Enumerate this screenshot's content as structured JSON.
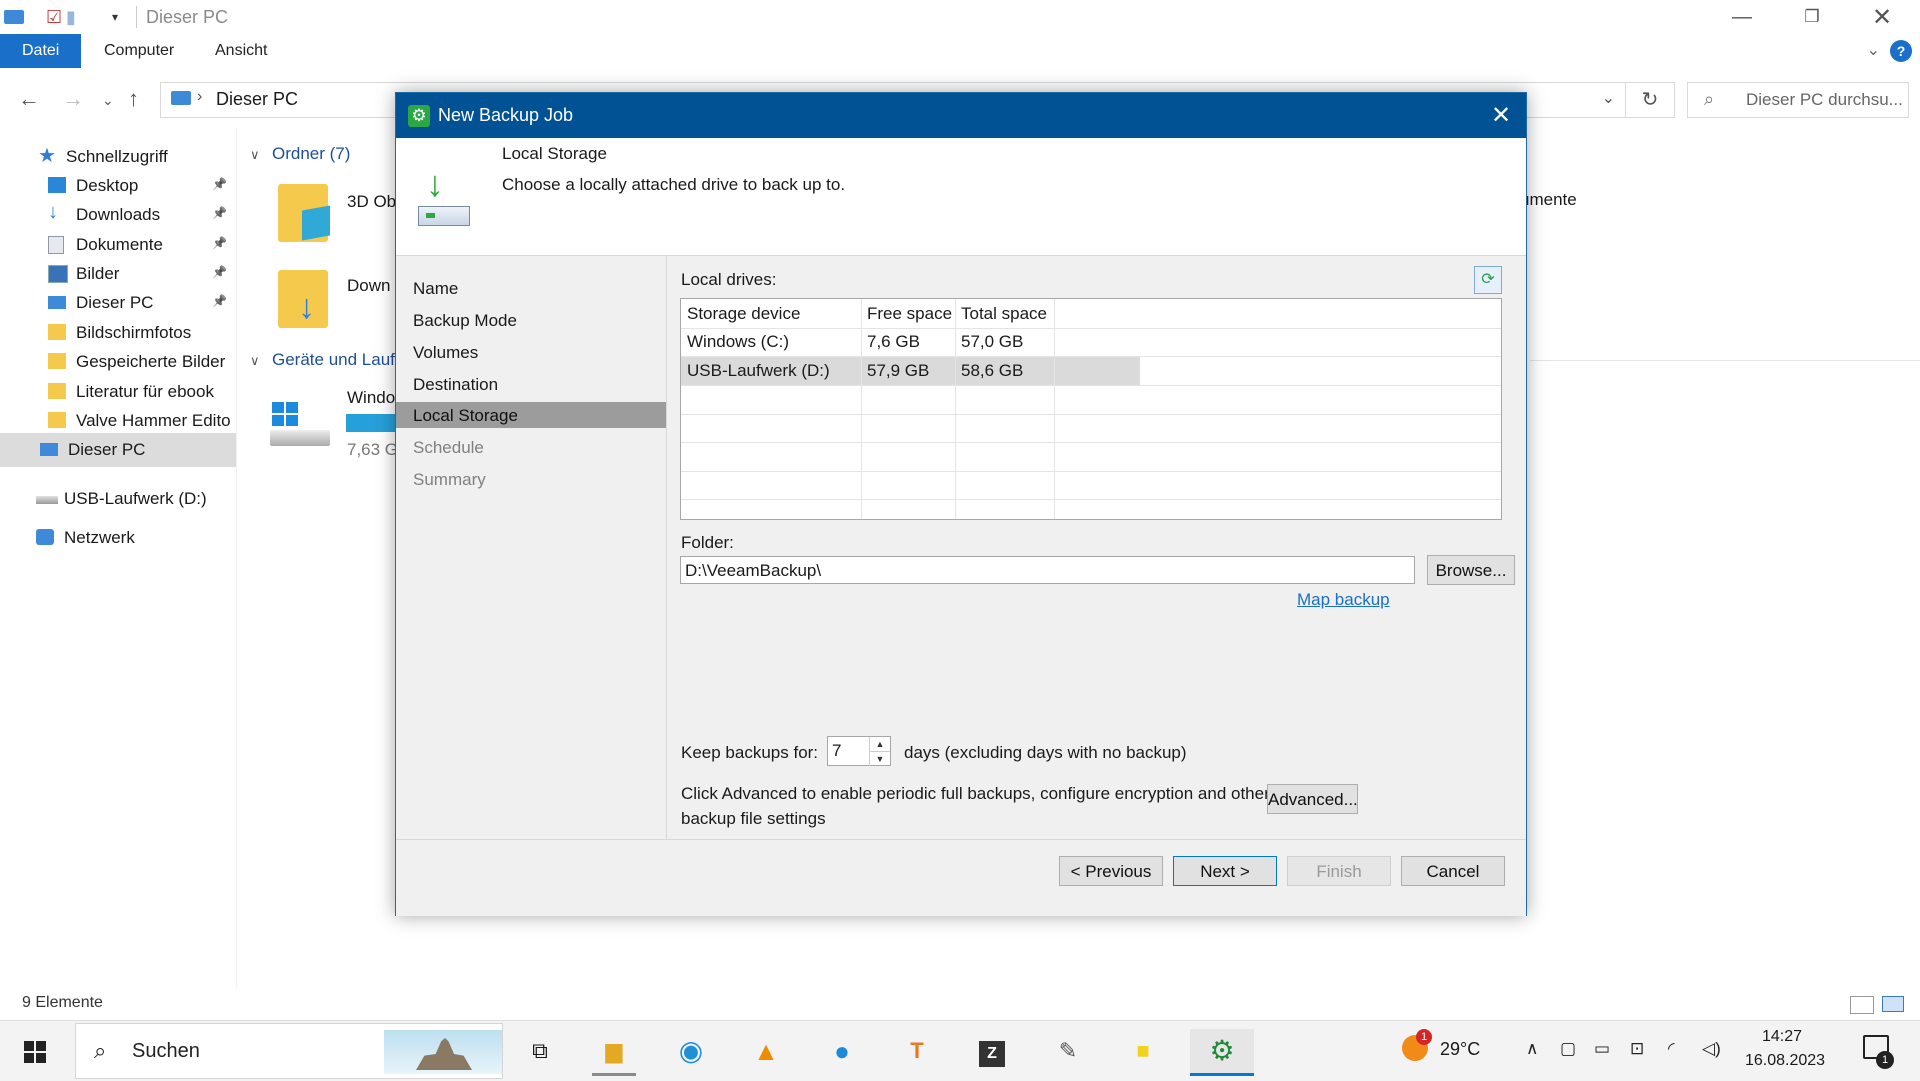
{
  "explorer": {
    "title": "Dieser PC",
    "ribbon_tabs": [
      "Datei",
      "Computer",
      "Ansicht"
    ],
    "address_path": "Dieser PC",
    "search_placeholder": "Dieser PC durchsu...",
    "sidebar": [
      {
        "label": "Schnellzugriff",
        "icon": "star-icon",
        "pinned": false
      },
      {
        "label": "Desktop",
        "icon": "desktop-icon",
        "pinned": true
      },
      {
        "label": "Downloads",
        "icon": "download-icon",
        "pinned": true
      },
      {
        "label": "Dokumente",
        "icon": "document-icon",
        "pinned": true
      },
      {
        "label": "Bilder",
        "icon": "pictures-icon",
        "pinned": true
      },
      {
        "label": "Dieser PC",
        "icon": "computer-icon",
        "pinned": true
      },
      {
        "label": "Bildschirmfotos",
        "icon": "folder-icon",
        "pinned": false
      },
      {
        "label": "Gespeicherte Bilder",
        "icon": "folder-icon",
        "pinned": false
      },
      {
        "label": "Literatur für ebook",
        "icon": "folder-icon",
        "pinned": false
      },
      {
        "label": "Valve Hammer Edito",
        "icon": "folder-icon",
        "pinned": false
      },
      {
        "label": "Dieser PC",
        "icon": "computer-icon",
        "pinned": false,
        "selected": true
      },
      {
        "label": "USB-Laufwerk (D:)",
        "icon": "usb-drive-icon",
        "pinned": false
      },
      {
        "label": "Netzwerk",
        "icon": "network-icon",
        "pinned": false
      }
    ],
    "groups": {
      "folders": "Ordner (7)",
      "devices": "Geräte und Lauf"
    },
    "content_items": {
      "folder1": "3D Ob",
      "folder2": "Down",
      "drive_name": "Windo",
      "drive_free": "7,63 G",
      "right_clip": "umente"
    },
    "status": "9 Elemente"
  },
  "dialog": {
    "title": "New Backup Job",
    "header_title": "Local Storage",
    "header_subtitle": "Choose a locally attached drive to back up to.",
    "steps": [
      {
        "label": "Name",
        "state": "done"
      },
      {
        "label": "Backup Mode",
        "state": "done"
      },
      {
        "label": "Volumes",
        "state": "done"
      },
      {
        "label": "Destination",
        "state": "done"
      },
      {
        "label": "Local Storage",
        "state": "active"
      },
      {
        "label": "Schedule",
        "state": "disabled"
      },
      {
        "label": "Summary",
        "state": "disabled"
      }
    ],
    "local_drives_label": "Local drives:",
    "columns": [
      "Storage device",
      "Free space",
      "Total space"
    ],
    "drives": [
      {
        "device": "Windows (C:)",
        "free": "7,6 GB",
        "total": "57,0 GB"
      },
      {
        "device": "USB-Laufwerk (D:)",
        "free": "57,9 GB",
        "total": "58,6 GB"
      }
    ],
    "folder_label": "Folder:",
    "folder_value": "D:\\VeeamBackup\\",
    "browse_label": "Browse...",
    "map_backup_label": "Map backup",
    "keep_label": "Keep backups for:",
    "keep_value": "7",
    "keep_suffix": "days (excluding days with no backup)",
    "advanced_text": "Click Advanced to enable periodic full backups, configure encryption and other backup file settings",
    "advanced_label": "Advanced...",
    "buttons": {
      "previous": "< Previous",
      "next": "Next >",
      "finish": "Finish",
      "cancel": "Cancel"
    }
  },
  "taskbar": {
    "search_text": "Suchen",
    "weather_temp": "29°C",
    "weather_badge": "1",
    "time": "14:27",
    "date": "16.08.2023",
    "notification_count": "1"
  },
  "colors": {
    "dialog_title_bar": "#005295",
    "ribbon_active": "#1a6fc9",
    "link": "#1a6fc9",
    "step_active": "#9c9c9c"
  }
}
